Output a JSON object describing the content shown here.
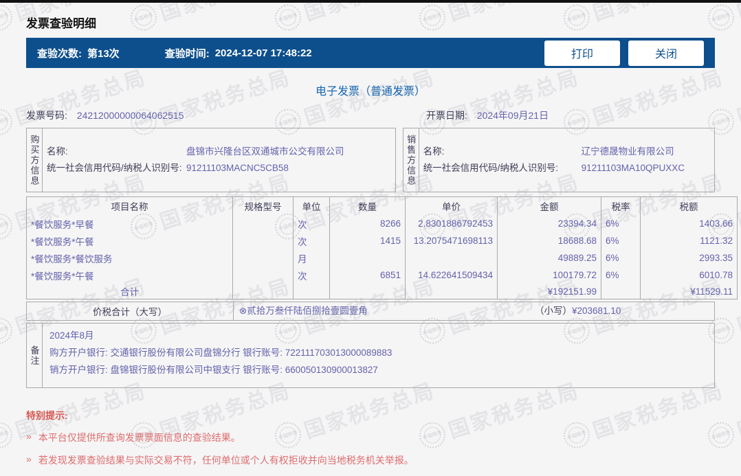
{
  "page": {
    "title": "发票查验明细"
  },
  "toolbar": {
    "check_count_label": "查验次数:",
    "check_count_value": "第13次",
    "check_time_label": "查验时间:",
    "check_time_value": "2024-12-07 17:48:22",
    "print_label": "打印",
    "close_label": "关闭"
  },
  "invoice": {
    "type_title": "电子发票（普通发票）",
    "number_label": "发票号码:",
    "number": "24212000000064062515",
    "date_label": "开票日期:",
    "date": "2024年09月21日",
    "buyer": {
      "panel_label": "购买方信息",
      "name_label": "名称:",
      "name": "盘锦市兴隆台区双通城市公交有限公司",
      "tax_id_label": "统一社会信用代码/纳税人识别号:",
      "tax_id": "91211103MACNC5CB58"
    },
    "seller": {
      "panel_label": "销售方信息",
      "name_label": "名称:",
      "name": "辽宁德晟物业有限公司",
      "tax_id_label": "统一社会信用代码/纳税人识别号:",
      "tax_id": "91211103MA10QPUXXC"
    },
    "items_table": {
      "headers": {
        "name": "项目名称",
        "spec": "规格型号",
        "unit": "单位",
        "qty": "数量",
        "price": "单价",
        "amount": "金额",
        "tax_rate": "税率",
        "tax": "税额"
      },
      "rows": [
        {
          "name": "*餐饮服务*早餐",
          "spec": "",
          "unit": "次",
          "qty": "8266",
          "price": "2.8301886792453",
          "amount": "23394.34",
          "tax_rate": "6%",
          "tax": "1403.66"
        },
        {
          "name": "*餐饮服务*午餐",
          "spec": "",
          "unit": "次",
          "qty": "1415",
          "price": "13.2075471698113",
          "amount": "18688.68",
          "tax_rate": "6%",
          "tax": "1121.32"
        },
        {
          "name": "*餐饮服务*餐饮服务",
          "spec": "",
          "unit": "月",
          "qty": "",
          "price": "",
          "amount": "49889.25",
          "tax_rate": "6%",
          "tax": "2993.35"
        },
        {
          "name": "*餐饮服务*午餐",
          "spec": "",
          "unit": "次",
          "qty": "6851",
          "price": "14.622641509434",
          "amount": "100179.72",
          "tax_rate": "6%",
          "tax": "6010.78"
        }
      ],
      "total_label": "合计",
      "total_amount": "¥192151.99",
      "total_tax": "¥11529.11"
    },
    "total_section": {
      "label": "价税合计（大写）",
      "words": "⊗贰拾万叁仟陆佰捌拾壹圆壹角",
      "small_label": "（小写）",
      "small_value": "¥203681.10"
    },
    "remarks": {
      "panel_label": "备注",
      "line1": "2024年8月",
      "line2": "购方开户银行: 交通银行股份有限公司盘锦分行 银行账号: 722111703013000089883",
      "line3": "销方开户银行: 盘锦银行股份有限公司中银支行 银行账号: 660050130900013827"
    }
  },
  "notice": {
    "title": "特别提示:",
    "bullet": "»",
    "item1": "本平台仅提供所查询发票票面信息的查验结果。",
    "item2": "若发现发票查验结果与实际交易不符，任何单位或个人有权拒收并向当地税务机关举报。"
  },
  "watermark": {
    "text": "国家税务总局",
    "sub_text": "中国税务"
  },
  "colors": {
    "toolbar_blue": "#0d4f8c",
    "title_blue": "#1766b0",
    "value_purple": "#6562aa",
    "label_dark": "#3f3e57",
    "notice_red": "#de6d6d",
    "border_gray": "#a8a8a8"
  }
}
